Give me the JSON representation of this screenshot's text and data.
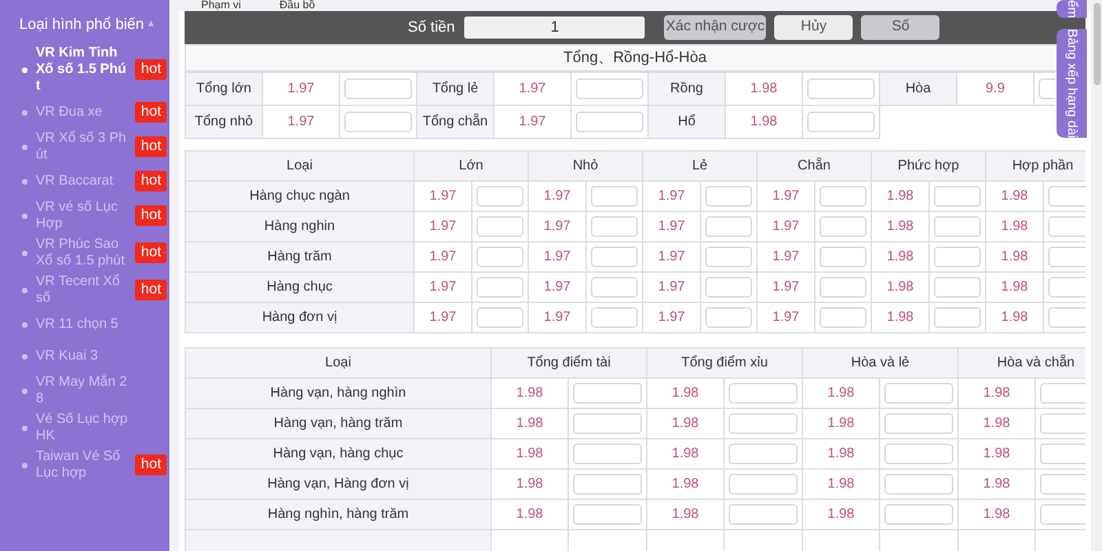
{
  "sidebar": {
    "title": "Loại hình phổ biến",
    "caret": "▲",
    "items": [
      {
        "label": "VR Kim Tinh Xố số 1.5 Phút",
        "badge": "hot",
        "selected": true
      },
      {
        "label": "VR Đua xe",
        "badge": "hot",
        "selected": false
      },
      {
        "label": "VR Xổ số 3 Phút",
        "badge": "hot",
        "selected": false
      },
      {
        "label": "VR Baccarat",
        "badge": "hot",
        "selected": false
      },
      {
        "label": "VR vé số Lục Hợp",
        "badge": "hot",
        "selected": false
      },
      {
        "label": "VR Phúc Sao Xổ số 1.5 phút",
        "badge": "hot",
        "selected": false
      },
      {
        "label": "VR Tecent Xổ số",
        "badge": "hot",
        "selected": false
      },
      {
        "label": "VR 11 chọn 5",
        "selected": false
      },
      {
        "label": "VR Kuai 3",
        "selected": false
      },
      {
        "label": "VR May Mắn 28",
        "selected": false
      },
      {
        "label": "Vé Số Lục hợp HK",
        "selected": false
      },
      {
        "label": "Taiwan Vé Số Lục hợp",
        "badge": "hot",
        "selected": false
      }
    ]
  },
  "top_row": [
    "Phạm vi",
    "Đầu bồ"
  ],
  "bet_bar": {
    "amount_label": "Số tiền",
    "amount_value": "1",
    "buttons": [
      {
        "label": "Xác nhận cược",
        "kind": "confirm"
      },
      {
        "label": "Hủy",
        "kind": "cancel"
      },
      {
        "label": "Số",
        "kind": "number"
      }
    ]
  },
  "section": {
    "title": "Tổng、Rồng-Hổ-Hòa",
    "rows": [
      [
        {
          "label": "Tổng lớn",
          "odds": "1.97"
        },
        {
          "label": "Tổng lẻ",
          "odds": "1.97"
        },
        {
          "label": "Rồng",
          "odds": "1.98"
        },
        {
          "label": "Hòa",
          "odds": "9.9"
        }
      ],
      [
        {
          "label": "Tổng nhỏ",
          "odds": "1.97"
        },
        {
          "label": "Tổng chẵn",
          "odds": "1.97"
        },
        {
          "label": "Hổ",
          "odds": "1.98"
        }
      ]
    ]
  },
  "table_1": {
    "columns": [
      "Loại",
      "Lớn",
      "Nhỏ",
      "Lẻ",
      "Chẵn",
      "Phức hợp",
      "Hợp phần"
    ],
    "rows": [
      {
        "label": "Hàng chục ngàn",
        "odds": [
          "1.97",
          "1.97",
          "1.97",
          "1.97",
          "1.98",
          "1.98"
        ]
      },
      {
        "label": "Hàng nghin",
        "odds": [
          "1.97",
          "1.97",
          "1.97",
          "1.97",
          "1.98",
          "1.98"
        ]
      },
      {
        "label": "Hàng trăm",
        "odds": [
          "1.97",
          "1.97",
          "1.97",
          "1.97",
          "1.98",
          "1.98"
        ]
      },
      {
        "label": "Hàng chục",
        "odds": [
          "1.97",
          "1.97",
          "1.97",
          "1.97",
          "1.98",
          "1.98"
        ]
      },
      {
        "label": "Hàng đơn vị",
        "odds": [
          "1.97",
          "1.97",
          "1.97",
          "1.97",
          "1.98",
          "1.98"
        ]
      }
    ]
  },
  "table_2": {
    "columns": [
      "Loại",
      "Tổng điểm tài",
      "Tổng điểm xỉu",
      "Hòa và lẻ",
      "Hòa và chẵn"
    ],
    "rows": [
      {
        "label": "Hàng vạn, hàng nghìn",
        "odds": [
          "1.98",
          "1.98",
          "1.98",
          "1.98"
        ]
      },
      {
        "label": "Hàng vạn, hàng trăm",
        "odds": [
          "1.98",
          "1.98",
          "1.98",
          "1.98"
        ]
      },
      {
        "label": "Hàng vạn, hàng chục",
        "odds": [
          "1.98",
          "1.98",
          "1.98",
          "1.98"
        ]
      },
      {
        "label": "Hàng vạn, Hàng đơn vị",
        "odds": [
          "1.98",
          "1.98",
          "1.98",
          "1.98"
        ]
      },
      {
        "label": "Hàng nghìn, hàng trăm",
        "odds": [
          "1.98",
          "1.98",
          "1.98",
          "1.98"
        ]
      }
    ]
  },
  "side_tabs": [
    "ểm",
    "Bảng xếp hạng dài"
  ]
}
